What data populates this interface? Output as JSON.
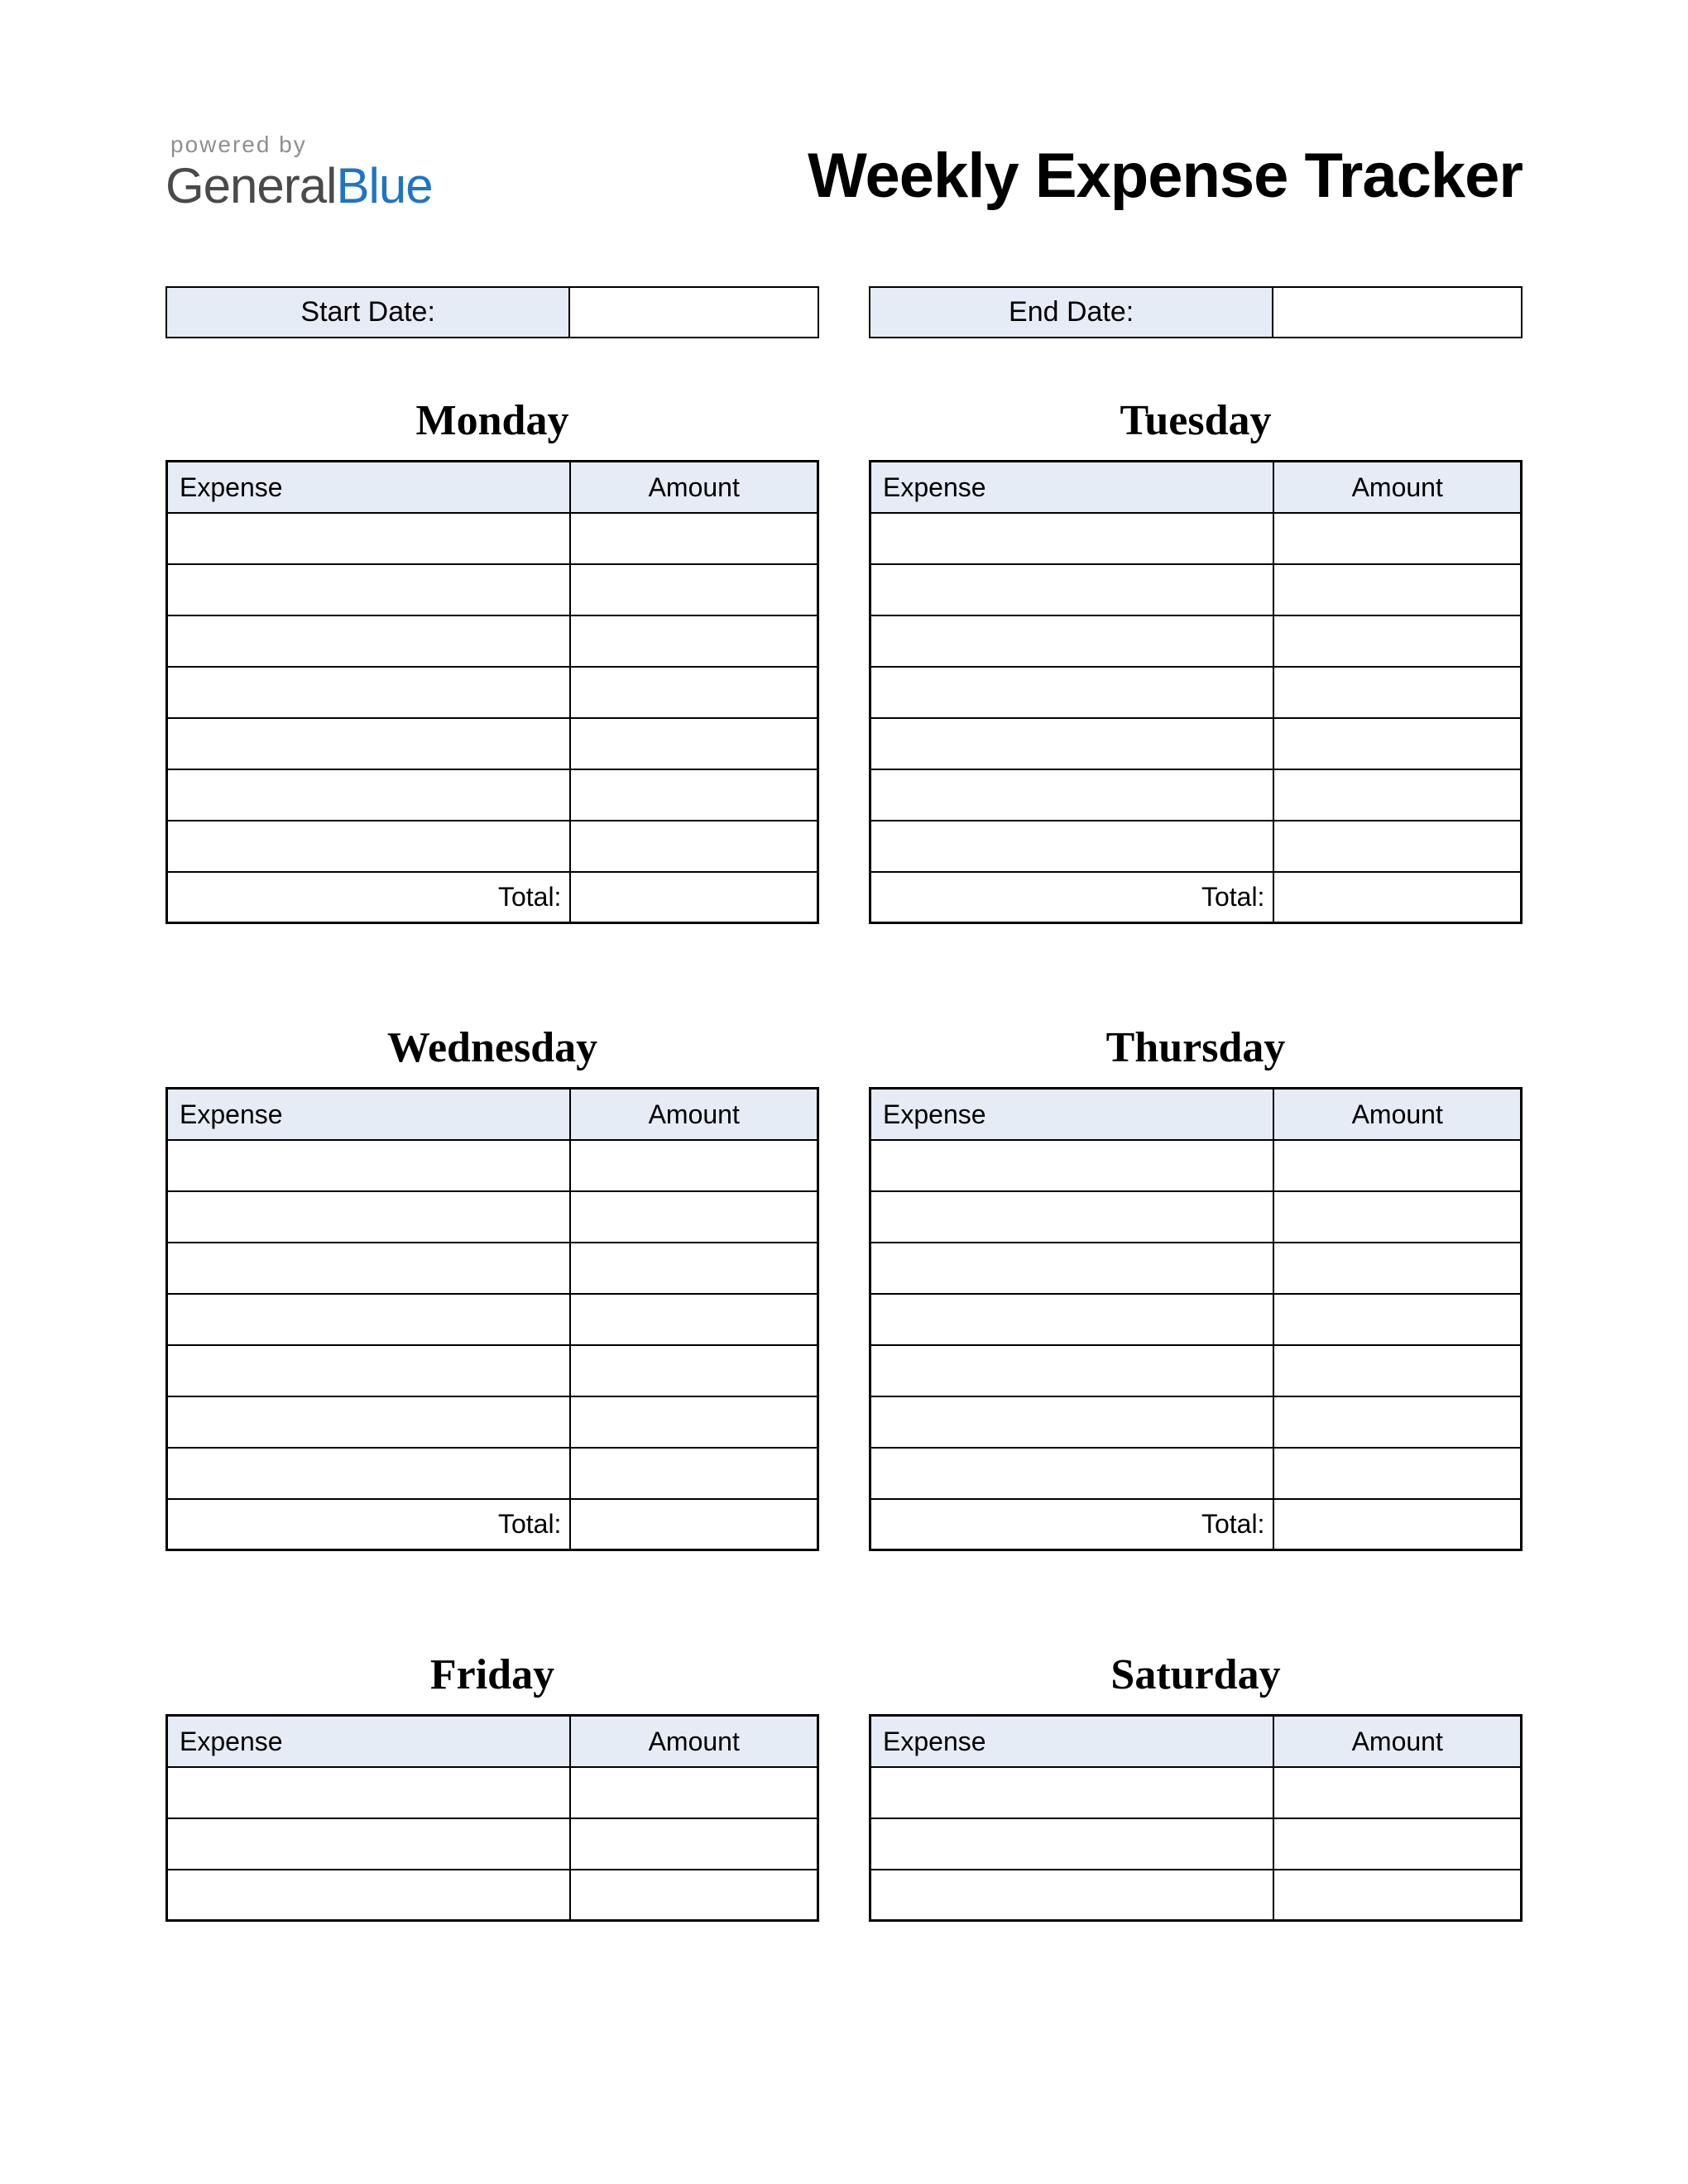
{
  "header": {
    "powered_by": "powered by",
    "logo_general": "General",
    "logo_blue": "Blue",
    "title": "Weekly Expense Tracker"
  },
  "dates": {
    "start_label": "Start Date:",
    "start_value": "",
    "end_label": "End Date:",
    "end_value": ""
  },
  "columns": {
    "expense": "Expense",
    "amount": "Amount"
  },
  "total_label": "Total:",
  "days": [
    {
      "name": "Monday",
      "rows": 7,
      "show_total": true
    },
    {
      "name": "Tuesday",
      "rows": 7,
      "show_total": true
    },
    {
      "name": "Wednesday",
      "rows": 7,
      "show_total": true
    },
    {
      "name": "Thursday",
      "rows": 7,
      "show_total": true
    },
    {
      "name": "Friday",
      "rows": 3,
      "show_total": false
    },
    {
      "name": "Saturday",
      "rows": 3,
      "show_total": false
    }
  ]
}
